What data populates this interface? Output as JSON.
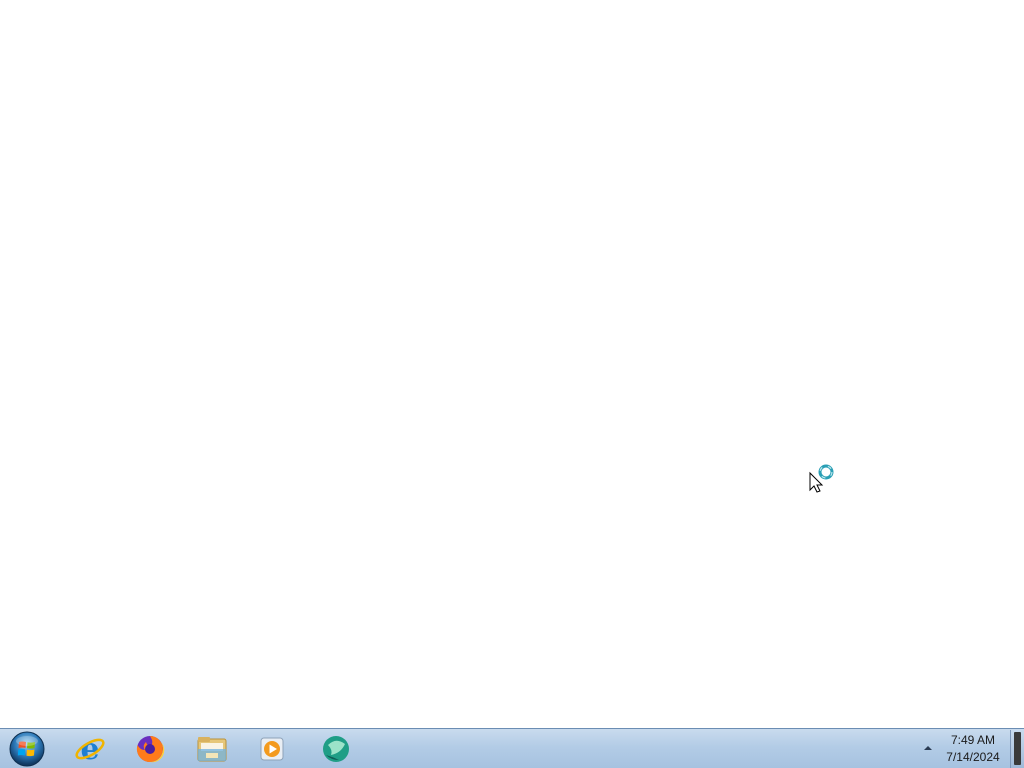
{
  "taskbar": {
    "pinned": [
      {
        "name": "Internet Explorer",
        "icon": "internet-explorer-icon"
      },
      {
        "name": "Firefox",
        "icon": "firefox-icon"
      },
      {
        "name": "Windows Explorer",
        "icon": "file-explorer-icon"
      },
      {
        "name": "Windows Media Player",
        "icon": "media-player-icon"
      },
      {
        "name": "App",
        "icon": "teal-app-icon"
      }
    ],
    "start_icon": "windows-start-orb-icon",
    "tray_icon": "show-hidden-icons-chevron",
    "clock": {
      "time": "7:49 AM",
      "date": "7/14/2024"
    }
  },
  "colors": {
    "desktop": "#ffffff",
    "taskbar": "#b3cce6"
  },
  "cursor": {
    "icon": "busy-cursor-icon"
  }
}
